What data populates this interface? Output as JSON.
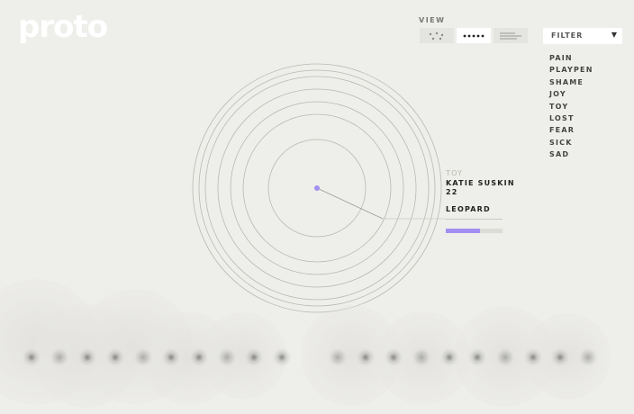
{
  "app": {
    "logo": "proto"
  },
  "view": {
    "label": "VIEW",
    "modes": [
      {
        "icon": "scatter-dots-icon",
        "active": false
      },
      {
        "icon": "row-dots-icon",
        "active": true
      },
      {
        "icon": "lines-icon",
        "active": false
      }
    ]
  },
  "filter": {
    "label": "FILTER",
    "options": [
      "PAIN",
      "PLAYPEN",
      "SHAME",
      "JOY",
      "TOY",
      "LOST",
      "FEAR",
      "SICK",
      "SAD"
    ]
  },
  "selection": {
    "category": "TOY",
    "name": "KATIE SUSKIN",
    "age": "22",
    "animal": "LEOPARD",
    "progress": 0.6
  },
  "colors": {
    "accent": "#a38ff0",
    "background": "#eeeeea",
    "ring": "#b9b9b4"
  }
}
